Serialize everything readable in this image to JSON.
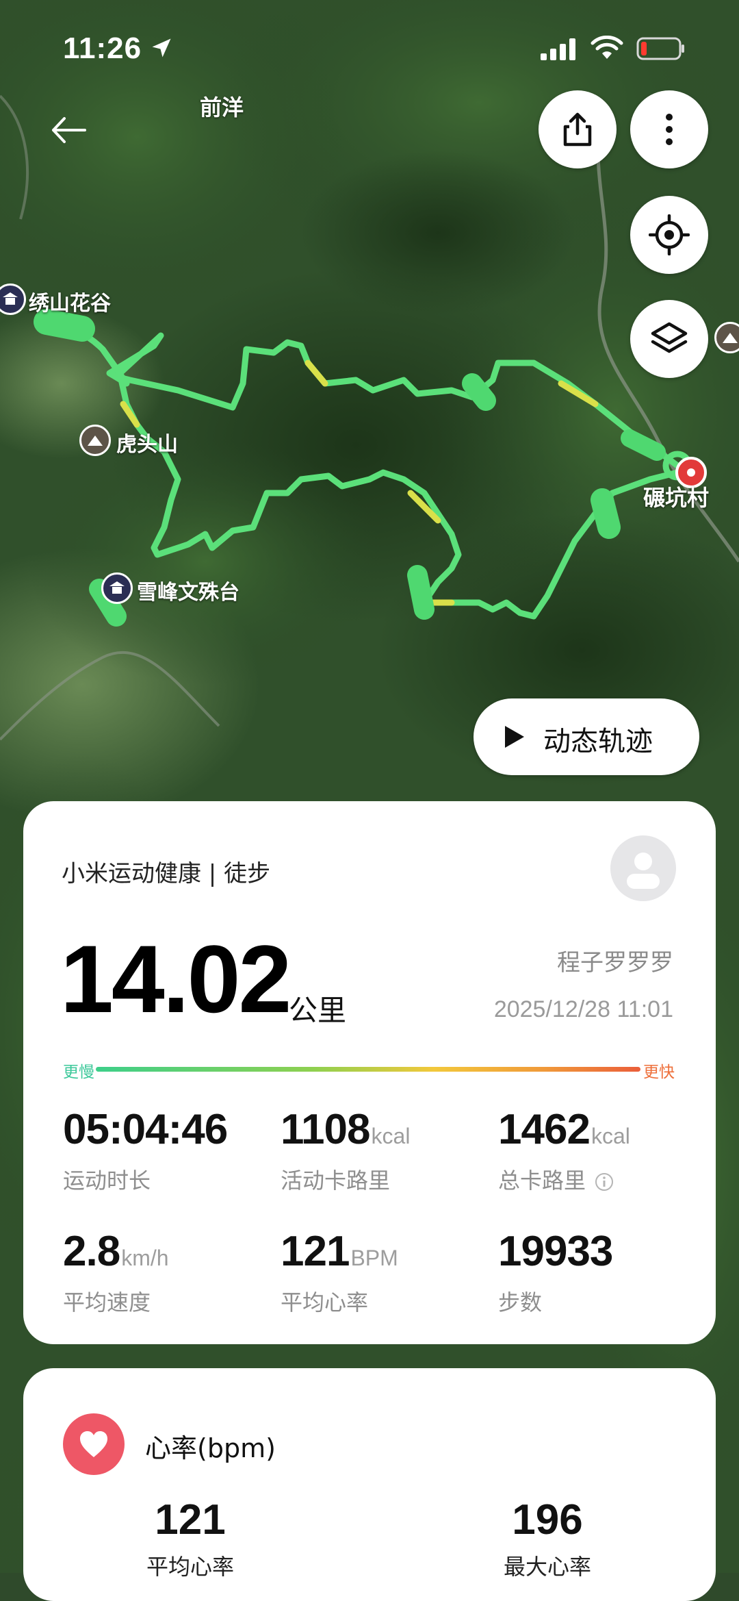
{
  "status_bar": {
    "time": "11:26"
  },
  "map": {
    "labels": {
      "qianyang": "前洋",
      "xiushan_huagu": "绣山花谷",
      "hutou_shan": "虎头山",
      "xuefeng_wenshutai": "雪峰文殊台",
      "niankeng_cun": "碾坑村"
    }
  },
  "buttons": {
    "replay_label": "动态轨迹"
  },
  "summary": {
    "app_label": "小米运动健康 | 徒步",
    "distance": "14.02",
    "distance_unit": "公里",
    "username": "程子罗罗罗",
    "datetime": "2025/12/28 11:01",
    "pace_slow_label": "更慢",
    "pace_fast_label": "更快",
    "stats": [
      {
        "value": "05:04:46",
        "unit": "",
        "label": "运动时长"
      },
      {
        "value": "1108",
        "unit": "kcal",
        "label": "活动卡路里"
      },
      {
        "value": "1462",
        "unit": "kcal",
        "label": "总卡路里"
      },
      {
        "value": "2.8",
        "unit": "km/h",
        "label": "平均速度"
      },
      {
        "value": "121",
        "unit": "BPM",
        "label": "平均心率"
      },
      {
        "value": "19933",
        "unit": "",
        "label": "步数"
      }
    ]
  },
  "heart_rate": {
    "title": "心率(bpm)",
    "avg_value": "121",
    "avg_label": "平均心率",
    "max_value": "196",
    "max_label": "最大心率"
  },
  "colors": {
    "track_green": "#5be07a",
    "track_yellow": "#d9e04a",
    "heart_red": "#ee5766",
    "pin_red": "#e23a3a"
  }
}
